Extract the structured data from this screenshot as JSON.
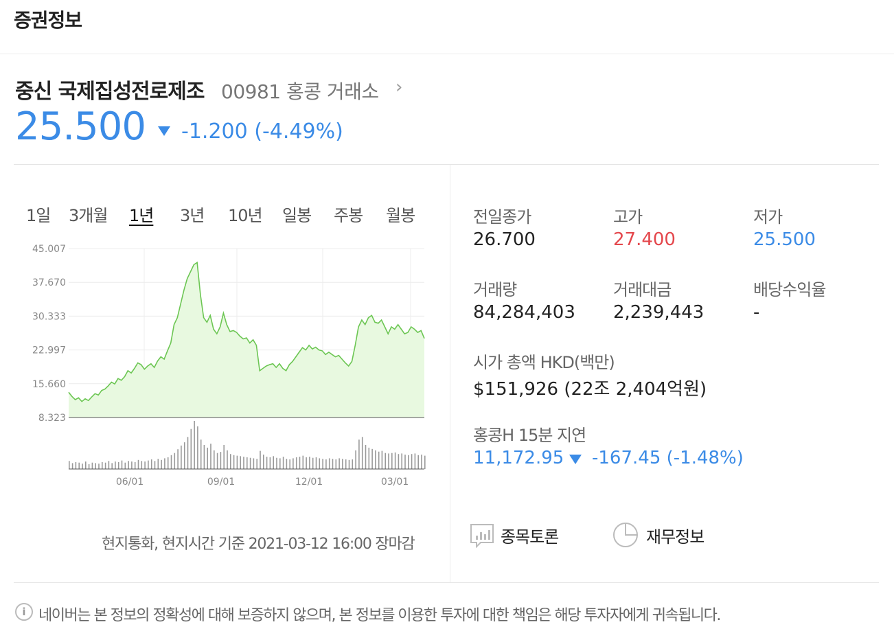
{
  "header": {
    "title": "증권정보"
  },
  "stock": {
    "name": "중신 국제집성전로제조",
    "code_exchange": "00981 홍콩 거래소",
    "chevron": "›",
    "price": "25.500",
    "change": "-1.200 (-4.49%)",
    "colors": {
      "down": "#3b8be6",
      "up": "#e4474c"
    }
  },
  "periods": [
    "1일",
    "3개월",
    "1년",
    "3년",
    "10년",
    "일봉",
    "주봉",
    "월봉"
  ],
  "active_period": "1년",
  "chart_data": {
    "type": "area",
    "ylim": [
      8.323,
      45.007
    ],
    "yticks": [
      "45.007",
      "37.670",
      "30.333",
      "22.997",
      "15.660",
      "8.323"
    ],
    "xticks": [
      "06/01",
      "09/01",
      "12/01",
      "03/01"
    ],
    "series": [
      {
        "values": [
          13.8,
          12.9,
          12.2,
          12.6,
          11.8,
          12.4,
          12.0,
          12.8,
          13.5,
          13.2,
          14.2,
          14.5,
          15.2,
          16.0,
          15.6,
          16.8,
          16.4,
          17.2,
          18.5,
          18.0,
          19.0,
          20.2,
          19.8,
          18.8,
          19.5,
          20.0,
          19.2,
          20.6,
          21.5,
          21.0,
          22.8,
          24.5,
          28.5,
          30.0,
          33.0,
          36.0,
          38.5,
          40.0,
          41.5,
          42.0,
          35.0,
          30.0,
          29.0,
          30.5,
          27.5,
          26.5,
          28.0,
          31.0,
          28.5,
          27.0,
          27.2,
          26.8,
          26.0,
          25.4,
          25.6,
          24.5,
          25.2,
          24.0,
          18.5,
          19.0,
          19.5,
          19.8,
          20.0,
          19.2,
          20.0,
          19.0,
          18.5,
          19.8,
          20.5,
          21.5,
          22.5,
          23.5,
          23.0,
          24.0,
          23.2,
          23.6,
          23.0,
          22.8,
          22.0,
          22.5,
          22.0,
          21.5,
          21.8,
          21.0,
          20.2,
          19.5,
          20.5,
          24.0,
          28.0,
          29.5,
          28.5,
          30.0,
          30.5,
          29.0,
          28.8,
          29.5,
          28.0,
          26.5,
          28.0,
          27.5,
          28.5,
          27.5,
          26.5,
          26.8,
          28.0,
          27.5,
          26.8,
          27.2,
          25.5
        ]
      }
    ],
    "volume": [
      30,
      22,
      26,
      24,
      20,
      28,
      18,
      24,
      22,
      20,
      26,
      24,
      30,
      22,
      28,
      26,
      32,
      24,
      30,
      28,
      26,
      34,
      30,
      28,
      32,
      36,
      30,
      38,
      34,
      40,
      44,
      52,
      60,
      74,
      88,
      100,
      120,
      150,
      180,
      160,
      110,
      90,
      80,
      95,
      70,
      60,
      64,
      90,
      70,
      56,
      52,
      50,
      48,
      46,
      44,
      42,
      40,
      38,
      68,
      54,
      46,
      44,
      48,
      42,
      40,
      46,
      38,
      36,
      40,
      44,
      46,
      50,
      44,
      46,
      42,
      44,
      40,
      38,
      36,
      40,
      38,
      36,
      40,
      38,
      36,
      34,
      36,
      70,
      110,
      120,
      90,
      80,
      75,
      70,
      65,
      68,
      60,
      58,
      60,
      62,
      56,
      58,
      54,
      52,
      56,
      58,
      52,
      54,
      50
    ]
  },
  "timestamp": "현지통화, 현지시간 기준 2021-03-12 16:00 장마감",
  "stats": [
    {
      "label": "전일종가",
      "value": "26.700",
      "tone": "normal"
    },
    {
      "label": "고가",
      "value": "27.400",
      "tone": "red"
    },
    {
      "label": "저가",
      "value": "25.500",
      "tone": "blue"
    },
    {
      "label": "거래량",
      "value": "84,284,403",
      "tone": "normal"
    },
    {
      "label": "거래대금",
      "value": "2,239,443",
      "tone": "normal"
    },
    {
      "label": "배당수익율",
      "value": "-",
      "tone": "normal"
    }
  ],
  "market_cap": {
    "label": "시가 총액 HKD(백만)",
    "value": "$151,926 (22조 2,404억원)"
  },
  "index": {
    "label": "홍콩H 15분 지연",
    "value": "11,172.95",
    "change": "-167.45 (-1.48%)"
  },
  "links": {
    "discussion": "종목토론",
    "financials": "재무정보"
  },
  "disclaimer": "네이버는 본 정보의 정확성에 대해 보증하지 않으며, 본 정보를 이용한 투자에 대한 책임은 해당 투자자에게 귀속됩니다."
}
